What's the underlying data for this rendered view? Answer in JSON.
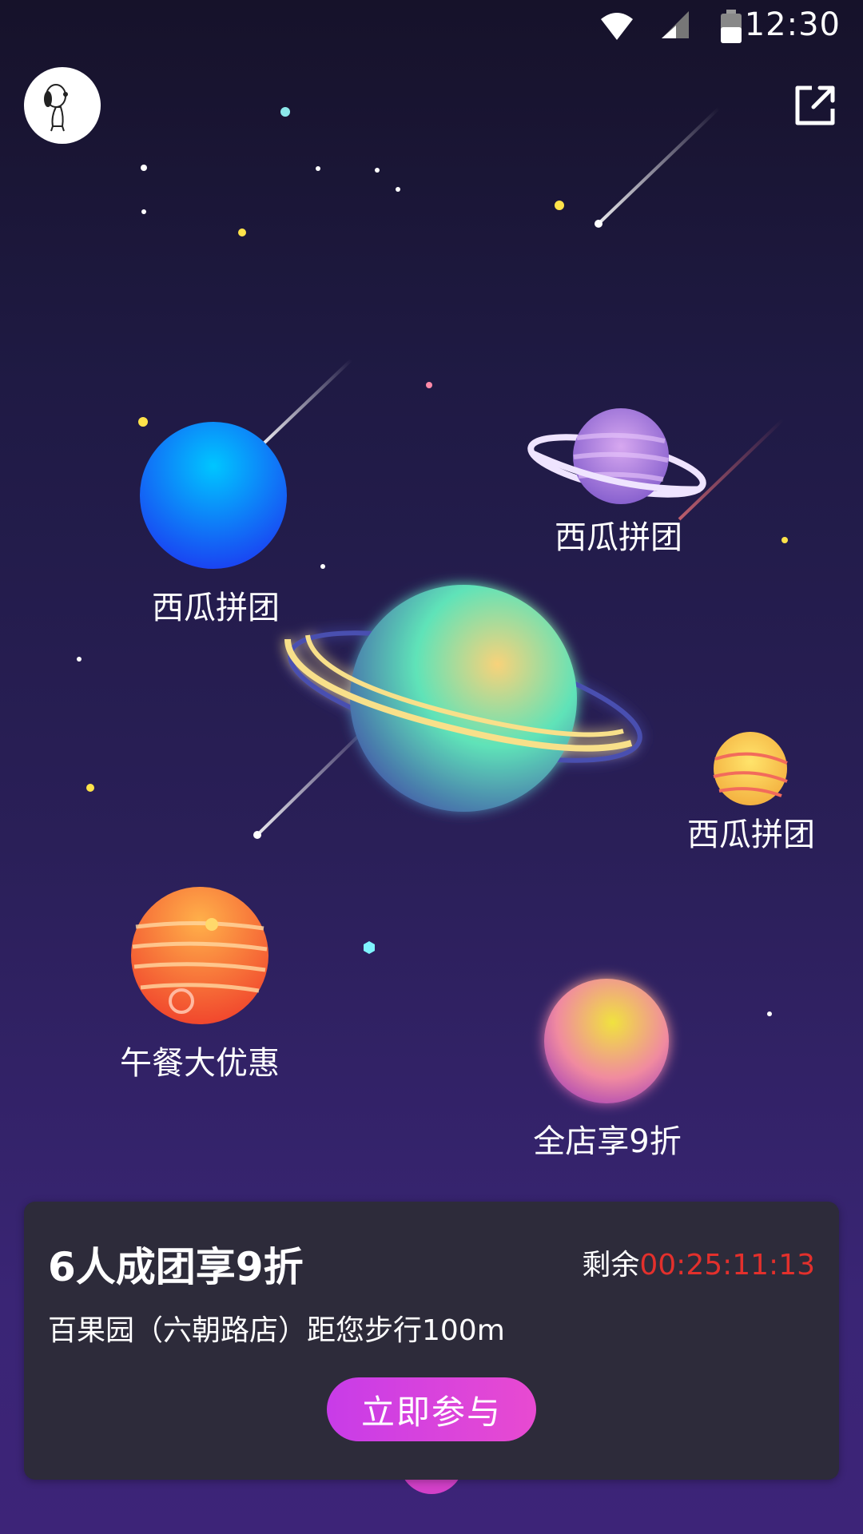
{
  "status_bar": {
    "time": "12:30"
  },
  "planets": [
    {
      "id": "blue",
      "label": "西瓜拼团"
    },
    {
      "id": "purple-ringed",
      "label": "西瓜拼团"
    },
    {
      "id": "small-yellow",
      "label": "西瓜拼团"
    },
    {
      "id": "red",
      "label": "午餐大优惠"
    },
    {
      "id": "pink",
      "label": "全店享9折"
    }
  ],
  "card": {
    "title": "6人成团享9折",
    "remain_label": "剩余",
    "countdown": "00:25:11:13",
    "address": "百果园（六朝路店）距您步行100m",
    "join_label": "立即参与"
  },
  "colors": {
    "countdown": "#e3302c",
    "join_button": "#d844dc"
  }
}
